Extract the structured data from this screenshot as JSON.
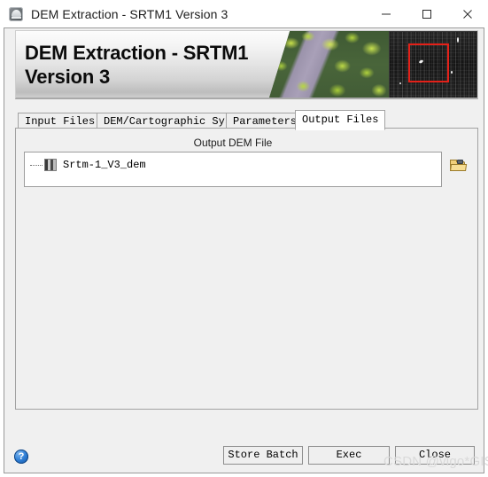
{
  "window": {
    "title": "DEM Extraction - SRTM1 Version 3",
    "app_icon": "globe-icon",
    "controls": {
      "minimize": "minimize-icon",
      "maximize": "maximize-icon",
      "close": "close-icon"
    }
  },
  "banner": {
    "title": "DEM Extraction - SRTM1 Version 3",
    "images": {
      "optical": "aerial-optical-thumbnail",
      "sar": "sar-grayscale-thumbnail",
      "highlight_box_color": "#e32119"
    }
  },
  "tabs": [
    {
      "label": "Input Files",
      "active": false
    },
    {
      "label": "DEM/Cartographic System",
      "active": false
    },
    {
      "label": "Parameters",
      "active": false
    },
    {
      "label": "Output Files",
      "active": true
    }
  ],
  "output_files_page": {
    "group_label": "Output DEM File",
    "list_items": [
      {
        "label": "Srtm-1_V3_dem",
        "icon": "raster-file-icon"
      }
    ],
    "browse_button": {
      "icon": "open-folder-icon",
      "tooltip": "Open"
    }
  },
  "footer": {
    "help_label": "?",
    "buttons": [
      {
        "name": "store-batch",
        "label": "Store Batch"
      },
      {
        "name": "exec",
        "label": "Exec"
      },
      {
        "name": "close",
        "label": "Close"
      }
    ]
  },
  "watermark": "CSDN @vigo*GIS",
  "colors": {
    "dialog_background": "#f0f0f0",
    "accent_red": "#e32119",
    "help_blue": "#2f7fd6",
    "folder_yellow": "#f0cf7a"
  }
}
